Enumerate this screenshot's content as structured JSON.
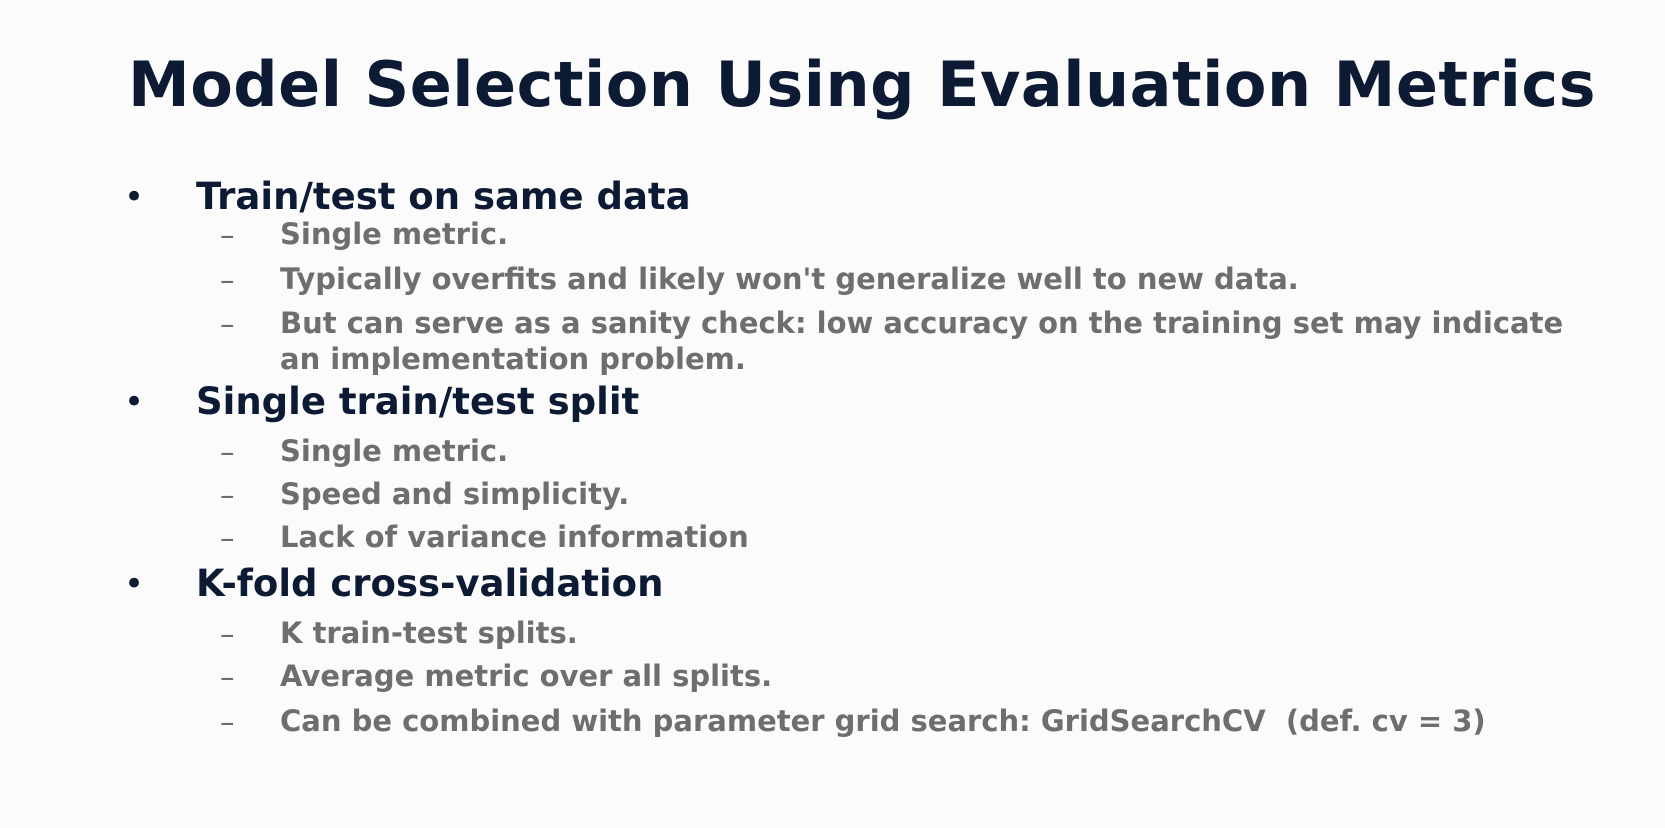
{
  "slide": {
    "title": "Model Selection Using Evaluation Metrics",
    "sections": [
      {
        "heading": "Train/test on same data",
        "items": [
          "Single metric.",
          "Typically overfits and likely won't generalize well to new data.",
          "But can serve as a sanity check: low accuracy on the training set may indicate an implementation problem."
        ]
      },
      {
        "heading": "Single train/test split",
        "items": [
          "Single metric.",
          "Speed and simplicity.",
          "Lack of variance information"
        ]
      },
      {
        "heading": "K-fold cross-validation",
        "items": [
          "K train-test splits.",
          "Average metric over all splits.",
          "Can be combined with parameter grid search: GridSearchCV  (def. cv = 3)"
        ]
      }
    ]
  }
}
